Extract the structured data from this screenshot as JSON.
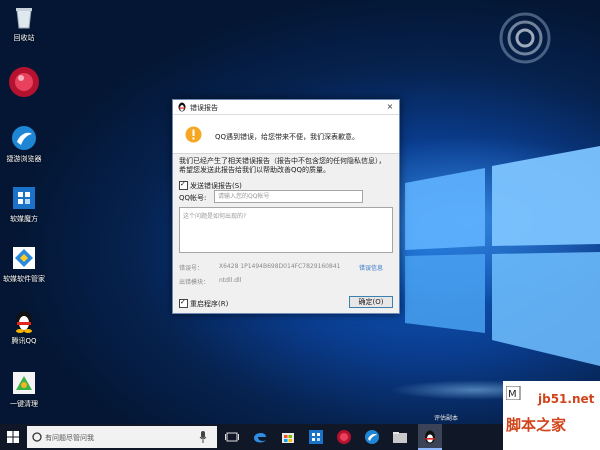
{
  "desktop": {
    "icons": [
      {
        "label": "回收站"
      },
      {
        "label": ""
      },
      {
        "label": "捷游浏览器"
      },
      {
        "label": "软媒魔方"
      },
      {
        "label": "软媒软件管家"
      },
      {
        "label": "腾讯QQ"
      },
      {
        "label": "一键清理"
      }
    ]
  },
  "dialog": {
    "title": "错误报告",
    "close_glyph": "×",
    "header_message": "QQ遇到错误，给您带来不便，我们深表歉意。",
    "description_line1": "我们已经产生了相关错误报告（报告中不包含您的任何隐私信息），",
    "description_line2": "希望您发送此报告给我们以帮助改善QQ的质量。",
    "send_report_label": "发送错误报告(S)",
    "qq_label": "QQ帐号:",
    "qq_placeholder": "请输入您的QQ帐号",
    "textarea_placeholder": "这个问题是如何出现的?",
    "error_code_label": "错误号：",
    "error_code_value": "X6428 1P1494B698D014FC7829160841",
    "error_details_link": "错误信息",
    "module_label": "出错模块：",
    "module_value": "ntdll.dll",
    "restart_label": "重启程序(R)",
    "ok_button": "确定(O)"
  },
  "taskbar": {
    "search_placeholder": "有问题尽管问我",
    "eval_text": "评估副本"
  },
  "watermark": {
    "site": "jb51.net",
    "name": "脚本之家"
  }
}
